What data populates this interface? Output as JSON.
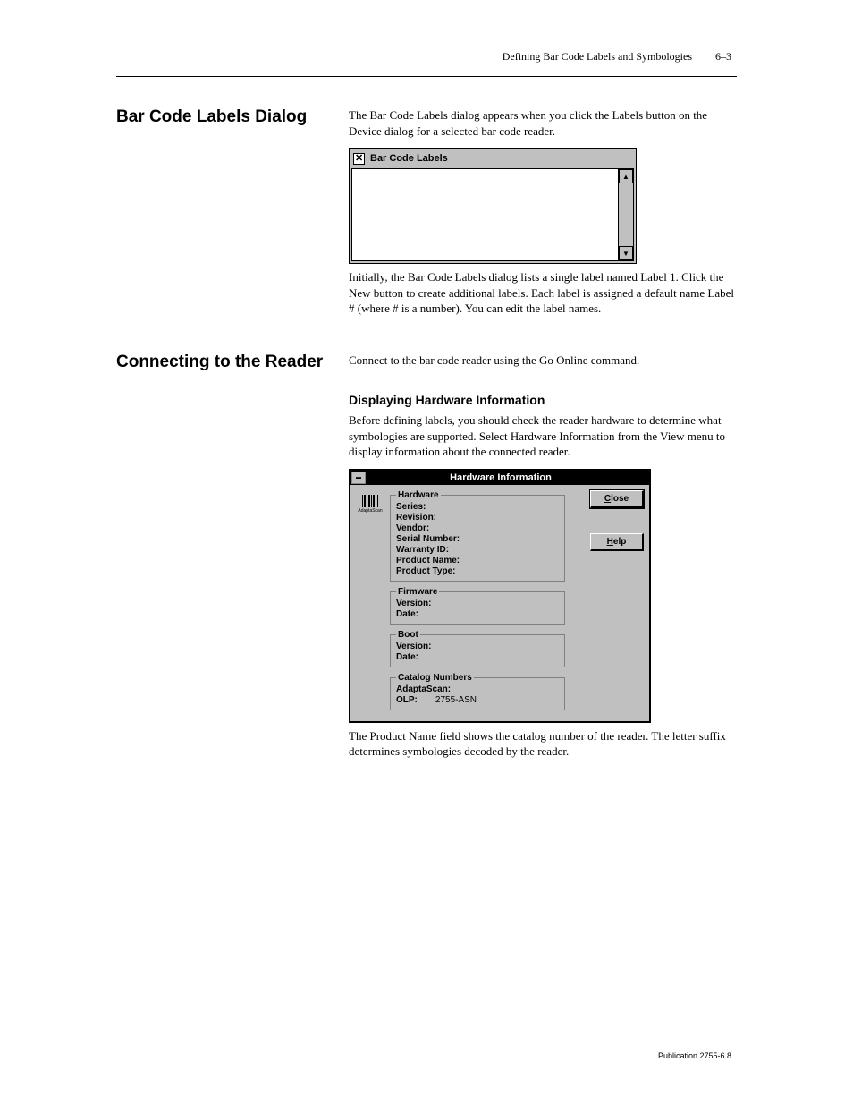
{
  "page": {
    "chapter": "Defining Bar Code Labels and Symbologies",
    "pagenum": "6–3",
    "pub": "Publication 2755-6.8"
  },
  "section1": {
    "title": "Bar Code Labels Dialog",
    "body": "The Bar Code Labels dialog appears when you click the  Labels  button on the Device dialog for a selected bar code reader.",
    "hint": "Initially, the Bar Code Labels dialog lists a single label named Label 1.  Click the New button to create additional labels.  Each label is assigned a default name Label # (where # is a number).  You can edit the label names.",
    "ss": {
      "checkbox_checked": true,
      "title": "Bar Code Labels"
    }
  },
  "section2": {
    "left_title": "Connecting to the Reader",
    "body": "Connect to the bar code reader using the Go Online command.",
    "sub": "Displaying Hardware Information",
    "sub_body": "Before defining labels, you should check the reader hardware to determine what symbologies are supported.   Select Hardware Information from the View menu to display information about the connected reader.",
    "ss": {
      "caption": "Hardware Information",
      "close": "Close",
      "help": "Help",
      "groups": {
        "hardware": {
          "legend": "Hardware",
          "fields": {
            "series": "Series:",
            "revision": "Revision:",
            "vendor": "Vendor:",
            "serial_number": "Serial Number:",
            "warranty_id": "Warranty ID:",
            "product_name": "Product Name:",
            "product_type": "Product Type:"
          }
        },
        "firmware": {
          "legend": "Firmware",
          "fields": {
            "version": "Version:",
            "date": "Date:"
          }
        },
        "boot": {
          "legend": "Boot",
          "fields": {
            "version": "Version:",
            "date": "Date:"
          }
        },
        "catalog": {
          "legend": "Catalog Numbers",
          "fields": {
            "adaptascan": "AdaptaScan:",
            "olp": "OLP:",
            "olp_val": "2755-ASN"
          }
        }
      }
    },
    "trailing": "The Product Name field shows the  catalog number of the reader.  The letter suffix determines symbologies decoded by the reader."
  }
}
